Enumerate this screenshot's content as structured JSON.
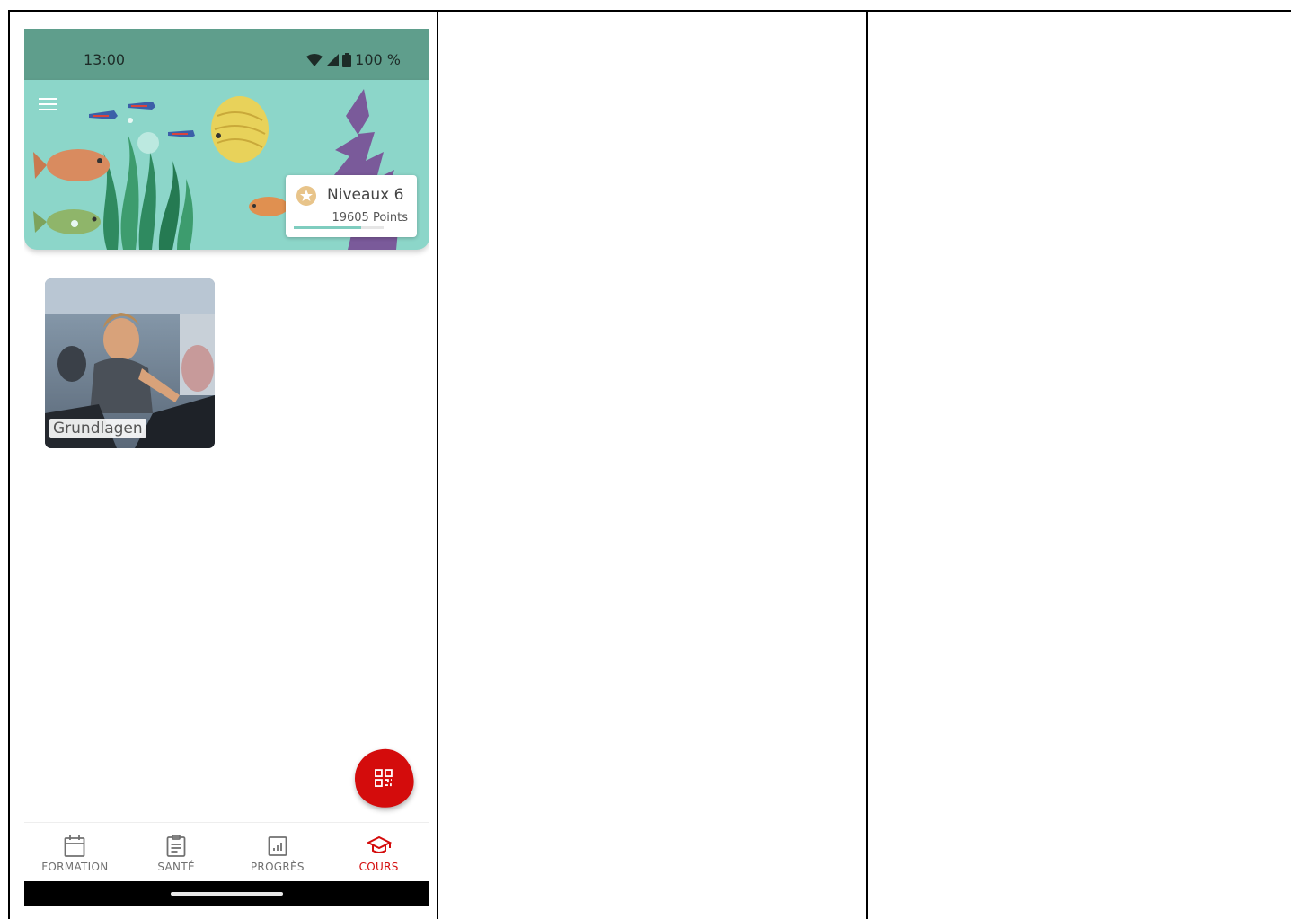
{
  "status_bar": {
    "time": "13:00",
    "battery": "100 %"
  },
  "header": {
    "level_label": "Niveaux 6",
    "points_label": "19605 Points",
    "level_progress": 0.75
  },
  "courses": [
    {
      "title": "Grundlagen"
    }
  ],
  "bottom_nav": {
    "items": [
      {
        "label": "FORMATION",
        "icon": "calendar-icon"
      },
      {
        "label": "SANTÉ",
        "icon": "clipboard-icon"
      },
      {
        "label": "PROGRÈS",
        "icon": "chart-icon"
      },
      {
        "label": "COURS",
        "icon": "graduation-cap-icon",
        "active": true
      }
    ]
  },
  "fab": {
    "icon": "qr-code-icon"
  },
  "colors": {
    "accent": "#d40c0c",
    "header_bg": "#8cd6c9",
    "status_bar_bg": "#5f9e8c"
  }
}
